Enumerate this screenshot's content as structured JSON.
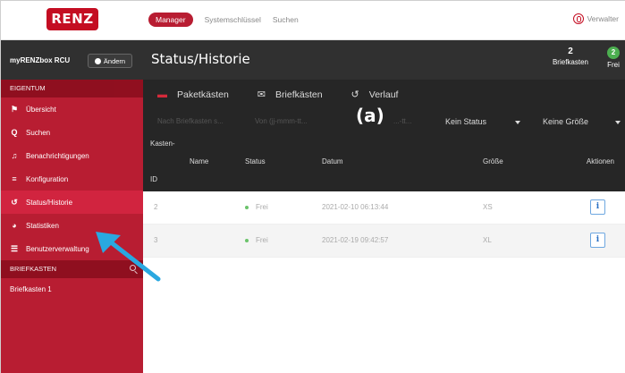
{
  "header": {
    "logo": "RENZ",
    "nav": [
      "Manager",
      "Systemschlüssel",
      "Suchen"
    ],
    "user": "Verwalter"
  },
  "sidebar": {
    "device": "myRENZbox RCU",
    "change_label": "Ändern",
    "section_property": "EIGENTUM",
    "items": [
      {
        "label": "Übersicht",
        "icon": "flag-icon"
      },
      {
        "label": "Suchen",
        "icon": "search-icon"
      },
      {
        "label": "Benachrichtigungen",
        "icon": "bell-icon"
      },
      {
        "label": "Konfiguration",
        "icon": "sliders-icon"
      },
      {
        "label": "Status/Historie",
        "icon": "history-icon"
      },
      {
        "label": "Statistiken",
        "icon": "pie-chart-icon"
      },
      {
        "label": "Benutzerverwaltung",
        "icon": "list-icon"
      }
    ],
    "section_mailbox": "BRIEFKASTEN",
    "mailbox_item": "Briefkasten 1"
  },
  "main": {
    "title": "Status/Historie",
    "stats": [
      {
        "value": "2",
        "label": "Briefkasten"
      },
      {
        "value": "2",
        "label": "Frei"
      }
    ],
    "tabs": [
      "Paketkästen",
      "Briefkästen",
      "Verlauf"
    ],
    "filters": {
      "placeholder1": "Nach Briefkasten s...",
      "placeholder2": "Von (jj-mmm-tt...",
      "placeholder3": "...-tt...",
      "status": "Kein Status",
      "size": "Keine Größe"
    },
    "annotation": "(a)",
    "columns": {
      "id_line1": "Kasten-",
      "id_line2": "ID",
      "name": "Name",
      "status": "Status",
      "date": "Datum",
      "size": "Größe",
      "actions": "Aktionen"
    },
    "rows": [
      {
        "id": "2",
        "status": "Frei",
        "date": "2021-02-10 06:13:44",
        "size": "XS",
        "action": "i"
      },
      {
        "id": "3",
        "status": "Frei",
        "date": "2021-02-19 09:42:57",
        "size": "XL",
        "action": "i"
      }
    ]
  },
  "colors": {
    "brand_red": "#b81d32",
    "active_item": "#d1243f",
    "header_dark": "#303030",
    "status_free": "#6bc36b",
    "arrow": "#2aa8e0"
  }
}
